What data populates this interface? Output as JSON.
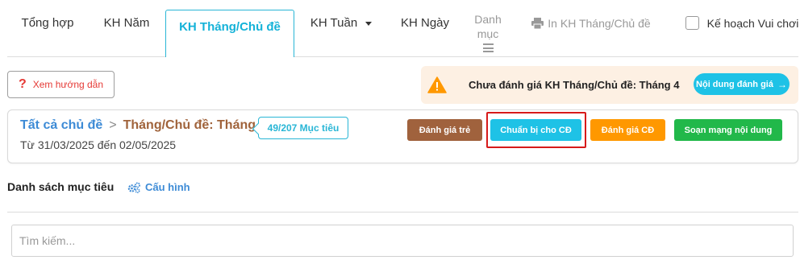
{
  "tabs": {
    "tonghop": "Tổng hợp",
    "nam": "KH Năm",
    "thang": "KH Tháng/Chủ đề",
    "tuan": "KH Tuần",
    "ngay": "KH Ngày",
    "danhmuc": [
      "Danh",
      "mục"
    ],
    "print": "In KH Tháng/Chủ đề",
    "vuichoi": "Kế hoạch Vui chơi"
  },
  "guide": {
    "label": "Xem hướng dẫn",
    "icon": "question-icon"
  },
  "alert": {
    "text": "Chưa đánh giá KH Tháng/Chủ đề: Tháng 4",
    "button": "Nội dung đánh giá",
    "arrow": "→"
  },
  "topic": {
    "all": "Tất cả chủ đề",
    "sep": ">",
    "current": "Tháng/Chủ đề: Tháng 4",
    "goals": "49/207 Mục tiêu",
    "daterange": "Từ 31/03/2025 đến 02/05/2025"
  },
  "actions": {
    "danhgia_tre": "Đánh giá trẻ",
    "chuanbi": "Chuẩn bị cho CĐ",
    "danhgia_cd": "Đánh giá CĐ",
    "soan": "Soạn mạng nội dung"
  },
  "section": {
    "title": "Danh sách mục tiêu",
    "config": "Cấu hình"
  },
  "search": {
    "placeholder": "Tìm kiếm..."
  },
  "colors": {
    "accent": "#1ec2e6",
    "active_tab": "#14b2d8",
    "brown": "#a0623d",
    "orange": "#ff9800",
    "green": "#21b84a",
    "link": "#3d8bd6",
    "highlight": "#d71a1a"
  }
}
